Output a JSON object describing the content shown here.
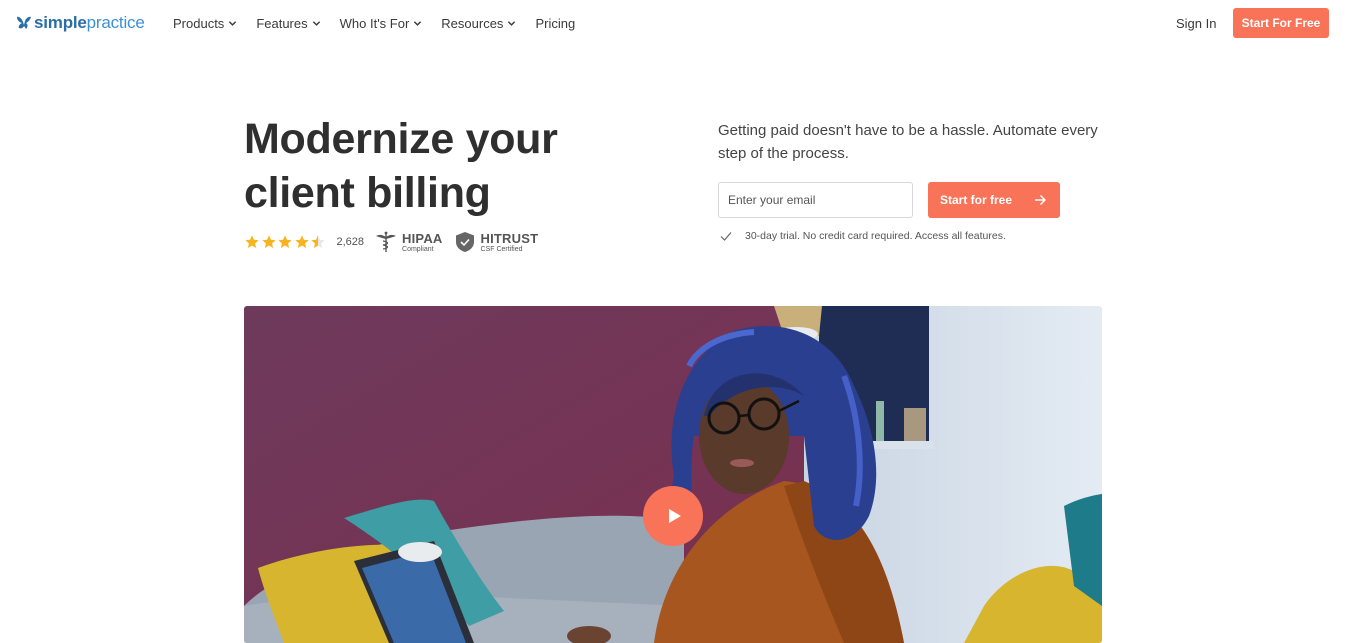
{
  "brand": {
    "name_bold": "simple",
    "name_light": "practice",
    "accent": "#f87358",
    "logo_color": "#2b6ea6"
  },
  "nav": {
    "items": [
      {
        "label": "Products",
        "has_dropdown": true
      },
      {
        "label": "Features",
        "has_dropdown": true
      },
      {
        "label": "Who It's For",
        "has_dropdown": true
      },
      {
        "label": "Resources",
        "has_dropdown": true
      },
      {
        "label": "Pricing",
        "has_dropdown": false
      }
    ],
    "signin_label": "Sign In",
    "cta_label": "Start For Free"
  },
  "hero": {
    "headline_line1": "Modernize your",
    "headline_line2": "client billing",
    "rating": {
      "stars": 4.5,
      "max_stars": 5,
      "count": "2,628"
    },
    "badges": [
      {
        "icon": "caduceus-icon",
        "title": "HIPAA",
        "subtitle": "Compliant"
      },
      {
        "icon": "shield-check-icon",
        "title": "HITRUST",
        "subtitle": "CSF Certified"
      }
    ],
    "subhead": "Getting paid doesn't have to be a hassle. Automate every step of the process.",
    "email_placeholder": "Enter your email",
    "email_value": "",
    "form_cta_label": "Start for free",
    "trial_note": "30-day trial. No credit card required. Access all features."
  },
  "video": {
    "description": "Woman with blue hair and glasses sitting on a grey sofa using a laptop",
    "play_icon": "play-icon"
  }
}
